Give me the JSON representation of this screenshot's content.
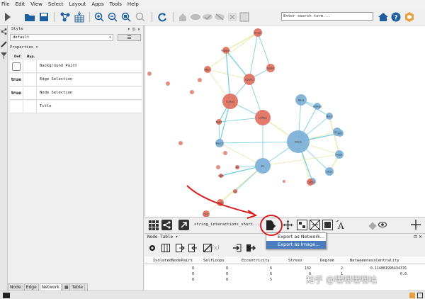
{
  "menu": [
    "File",
    "Edit",
    "View",
    "Select",
    "Layout",
    "Apps",
    "Tools",
    "Help"
  ],
  "search": {
    "placeholder": "Enter search term..."
  },
  "style_panel": {
    "header": "Style",
    "style_name": "default",
    "properties_label": "Properties",
    "col_def": "Def.",
    "col_byp": "Byp.",
    "rows": [
      {
        "def": "",
        "label": "Background Paint"
      },
      {
        "def": "true",
        "label": "Edge Selection"
      },
      {
        "def": "true",
        "label": "Node Selection"
      },
      {
        "def": "",
        "label": "Title"
      }
    ]
  },
  "left_tabs": [
    "Node",
    "Edge",
    "Network",
    "Table"
  ],
  "network": {
    "title": "string_interactions_short....",
    "nodes": [
      {
        "label": "Amp1"
      },
      {
        "label": "Kappa1"
      },
      {
        "label": "Glob1"
      },
      {
        "label": "Kap1"
      },
      {
        "label": "Col3a1"
      },
      {
        "label": "Col1a1"
      },
      {
        "label": "Col6a1"
      },
      {
        "label": "Kap3"
      },
      {
        "label": "Rocc1"
      },
      {
        "label": "Nas1"
      },
      {
        "label": "Ndmp2"
      },
      {
        "label": "Hs"
      },
      {
        "label": "Nmrp"
      },
      {
        "label": "Ssk1"
      },
      {
        "label": "Hif1"
      },
      {
        "label": "Gsk1"
      },
      {
        "label": "Rspo"
      },
      {
        "label": "Sbs1"
      },
      {
        "label": "Frg1"
      },
      {
        "label": "Lef1"
      },
      {
        "label": "Ifn"
      },
      {
        "label": "Frzb"
      },
      {
        "label": "Cst"
      },
      {
        "label": "Fgf5"
      },
      {
        "label": "Ctr1"
      }
    ],
    "colors": {
      "red": "#e07060",
      "blue": "#7fb1d8",
      "edge_blue": "#6ecbe0",
      "edge_yellow": "#e6e6a0"
    }
  },
  "popup": {
    "items": [
      "Export as Network...",
      "Export as Image..."
    ]
  },
  "table": {
    "title": "Node Table",
    "columns": [
      "SelfLoops",
      "Eccentricity",
      "Stress",
      "Degree",
      "BetweennessCentrality"
    ],
    "first_col": "IsolatedNodePairs",
    "rows": [
      {
        "a": "0",
        "b": "0",
        "c": "6",
        "d": "132",
        "e": "2",
        "f": "0.114081996434376"
      },
      {
        "a": "0",
        "b": "0",
        "c": "6",
        "d": "0",
        "e": "1",
        "f": "0.0"
      },
      {
        "a": "0",
        "b": "0",
        "c": "5",
        "d": "",
        "e": "",
        "f": ""
      }
    ]
  },
  "watermark": "知乎 @嘿嘿嘿嘿咕"
}
